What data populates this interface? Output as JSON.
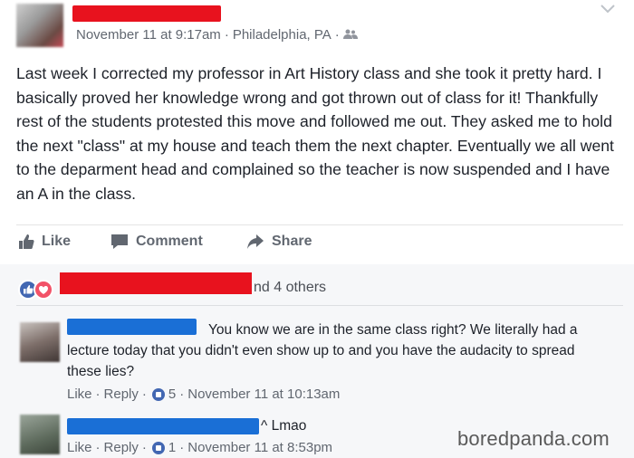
{
  "post": {
    "timestamp": "November 11 at 9:17am",
    "location": "Philadelphia, PA",
    "separator": "·",
    "privacy_icon": "friends-icon",
    "options_icon": "chevron-down-icon",
    "body": "Last week I corrected my professor in Art History class and she took it pretty hard. I basically proved her knowledge wrong and got thrown out of class for it! Thankfully rest of the students protested this move and followed me out. They asked me to hold the next \"class\" at my house and teach them the next chapter. Eventually we all went to the deparment head and complained so the teacher is now suspended and I have an A in the class."
  },
  "actions": {
    "like": "Like",
    "comment": "Comment",
    "share": "Share"
  },
  "reactions": {
    "likes_text": "nd 4 others",
    "icons": [
      "like-reaction-icon",
      "love-reaction-icon"
    ]
  },
  "comments": [
    {
      "text": "You know we are in the same class right? We literally had a lecture today that you didn't even show up to and you have the audacity to spread these lies?",
      "like": "Like",
      "reply": "Reply",
      "like_count": "5",
      "timestamp": "November 11 at 10:13am"
    },
    {
      "text": "^ Lmao",
      "like": "Like",
      "reply": "Reply",
      "like_count": "1",
      "timestamp": "November 11 at 8:53pm"
    }
  ],
  "watermark": "boredpanda.com",
  "colors": {
    "redaction_red": "#e8121e",
    "redaction_blue": "#1a6fd6",
    "facebook_blue": "#4267b2",
    "love_red": "#f25268",
    "meta_gray": "#616770"
  }
}
